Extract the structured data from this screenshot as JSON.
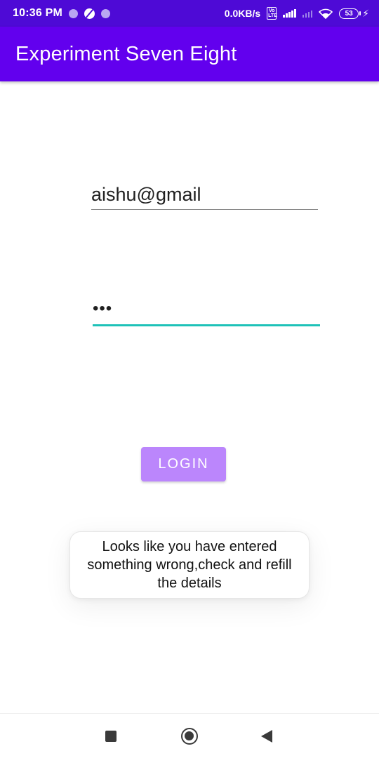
{
  "status_bar": {
    "time": "10:36 PM",
    "network_speed": "0.0KB/s",
    "volte": "Vo LTE",
    "battery_level": "53",
    "icons": [
      "notification-dot-icon",
      "circle-slash-icon",
      "notification-dot-icon",
      "signal-icon",
      "signal-noservice-icon",
      "wifi-icon",
      "battery-icon",
      "charging-bolt-icon"
    ]
  },
  "app_bar": {
    "title": "Experiment Seven Eight",
    "color": "#6200ee"
  },
  "form": {
    "email_value": "aishu@gmail",
    "password_value": "•••",
    "login_label": "LOGIN",
    "login_color": "#bb86fc",
    "focus_color": "#1ec2b8"
  },
  "toast": {
    "message": "Looks like you have entered something wrong,check and refill the details"
  },
  "nav_bar": {
    "icons": [
      "recents-icon",
      "home-icon",
      "back-icon"
    ]
  }
}
